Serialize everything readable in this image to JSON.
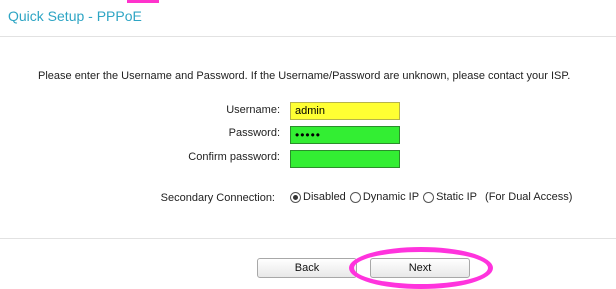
{
  "page": {
    "title": "Quick Setup - PPPoE",
    "instruction": "Please enter the Username and Password. If the Username/Password are unknown, please contact your ISP."
  },
  "form": {
    "username_label": "Username:",
    "username_value": "admin",
    "password_label": "Password:",
    "password_value": "•••••",
    "confirm_label": "Confirm password:",
    "confirm_value": "",
    "secondary_label": "Secondary Connection:",
    "secondary_options": [
      "Disabled",
      "Dynamic IP",
      "Static IP"
    ],
    "secondary_selected": "Disabled",
    "secondary_note": "(For Dual Access)"
  },
  "buttons": {
    "back": "Back",
    "next": "Next"
  },
  "colors": {
    "title": "#2ea5c4",
    "username_field": "#ffff33",
    "password_field": "#33ee33",
    "highlight": "#ff33dd"
  }
}
